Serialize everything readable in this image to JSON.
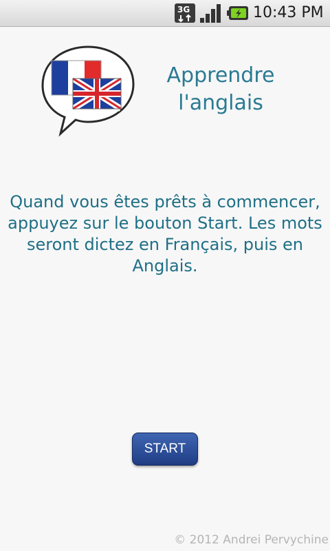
{
  "status_bar": {
    "network_icon": "3g-data-icon",
    "signal_icon": "signal-strength-icon",
    "battery_icon": "battery-charging-icon",
    "time": "10:43 PM"
  },
  "header": {
    "logo_icon": "french-english-flags-speech-bubble-icon",
    "title_line1": "Apprendre",
    "title_line2": "l'anglais"
  },
  "main": {
    "instructions": "Quand vous êtes prêts à commencer, appuyez sur le bouton Start. Les mots seront dictez en Français, puis en Anglais."
  },
  "actions": {
    "start_label": "START"
  },
  "footer": {
    "copyright": "© 2012 Andrei Pervychine"
  },
  "colors": {
    "title": "#2a7a93",
    "button": "#2c4f9e",
    "background": "#f7f7f7"
  }
}
